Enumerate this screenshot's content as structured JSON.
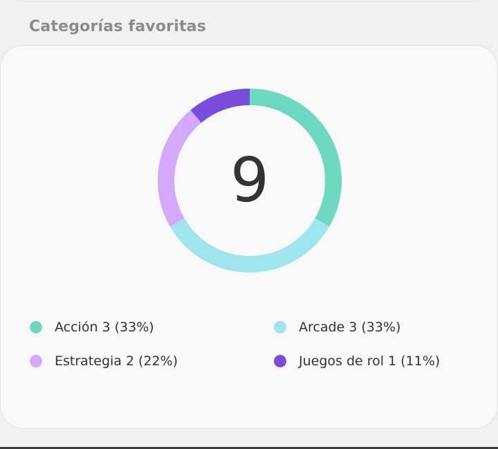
{
  "section": {
    "title": "Categorías favoritas"
  },
  "summary": {
    "total": "9"
  },
  "colors": {
    "Acción": "#6ed9c1",
    "Arcade": "#9ee5ee",
    "Estrategia": "#d4a8fa",
    "Juegos de rol": "#7a4cdc"
  },
  "categories": [
    {
      "name": "Acción",
      "count": 3,
      "percent": "(33%)",
      "color": "#6ed9c1"
    },
    {
      "name": "Arcade",
      "count": 3,
      "percent": "(33%)",
      "color": "#9ee5ee"
    },
    {
      "name": "Estrategia",
      "count": 2,
      "percent": "(22%)",
      "color": "#d4a8fa"
    },
    {
      "name": "Juegos de rol",
      "count": 1,
      "percent": "(11%)",
      "color": "#7a4cdc"
    }
  ]
}
